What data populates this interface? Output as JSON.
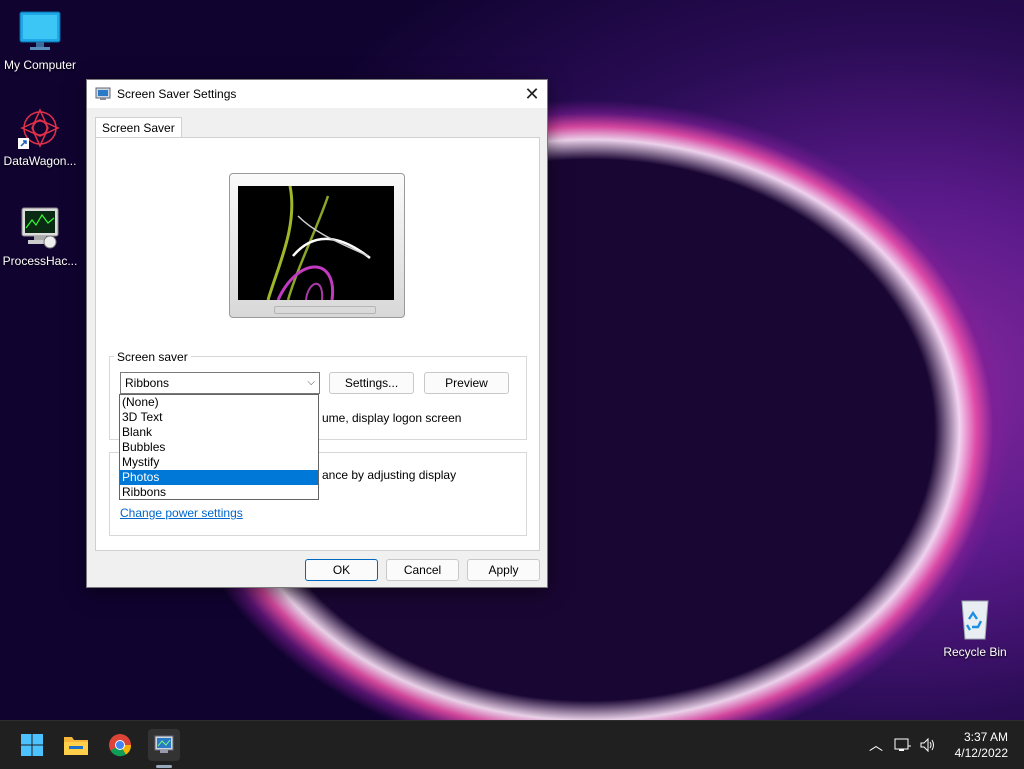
{
  "desktop": {
    "icons": [
      {
        "label": "My Computer"
      },
      {
        "label": "DataWagon..."
      },
      {
        "label": "ProcessHac..."
      },
      {
        "label": "Recycle Bin"
      }
    ]
  },
  "dialog": {
    "title": "Screen Saver Settings",
    "tab_label": "Screen Saver",
    "screen_saver_group_label": "Screen saver",
    "selected_saver": "Ribbons",
    "settings_button": "Settings...",
    "preview_button": "Preview",
    "resume_text_fragment": "ume, display logon screen",
    "power_text_fragment": "ance by adjusting display",
    "power_link": "Change power settings",
    "ok_button": "OK",
    "cancel_button": "Cancel",
    "apply_button": "Apply",
    "dropdown_options": [
      "(None)",
      "3D Text",
      "Blank",
      "Bubbles",
      "Mystify",
      "Photos",
      "Ribbons"
    ],
    "highlighted_option": "Photos"
  },
  "taskbar": {
    "pinned": [
      "start-icon",
      "file-explorer-icon",
      "chrome-icon",
      "screensaver-app-icon"
    ],
    "time": "3:37 AM",
    "date": "4/12/2022"
  },
  "colors": {
    "accent": "#0078d7",
    "link": "#0066cc",
    "taskbar": "#202020"
  }
}
